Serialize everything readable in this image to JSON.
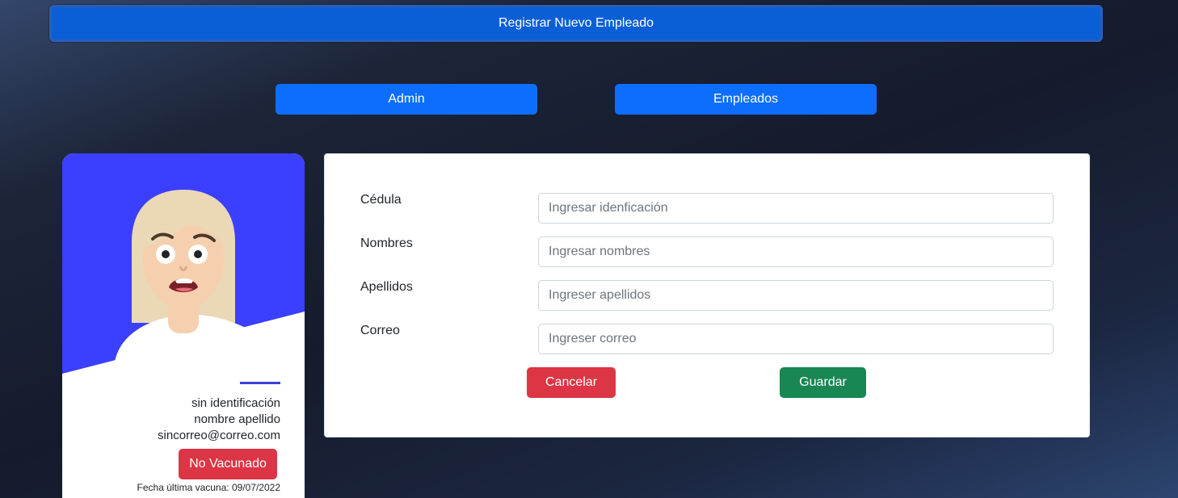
{
  "header": {
    "title": "Registrar Nuevo Empleado"
  },
  "nav": {
    "admin_label": "Admin",
    "employees_label": "Empleados"
  },
  "profile_card": {
    "avatar_icon": "woman-avatar-icon",
    "identification": "sin identificación",
    "full_name": "nombre apellido",
    "email": "sincorreo@correo.com",
    "status": "No Vacunado",
    "last_vaccine": "Fecha última vacuna: 09/07/2022",
    "accent_color": "#3b3fff"
  },
  "form": {
    "fields": [
      {
        "label": "Cédula",
        "placeholder": "Ingresar idenficación",
        "value": ""
      },
      {
        "label": "Nombres",
        "placeholder": "Ingresar nombres",
        "value": ""
      },
      {
        "label": "Apellidos",
        "placeholder": "Ingreser apellidos",
        "value": ""
      },
      {
        "label": "Correo",
        "placeholder": "Ingreser correo",
        "value": ""
      }
    ],
    "cancel_label": "Cancelar",
    "save_label": "Guardar"
  },
  "colors": {
    "primary": "#0d6efd",
    "danger": "#dc3545",
    "success": "#198754"
  }
}
